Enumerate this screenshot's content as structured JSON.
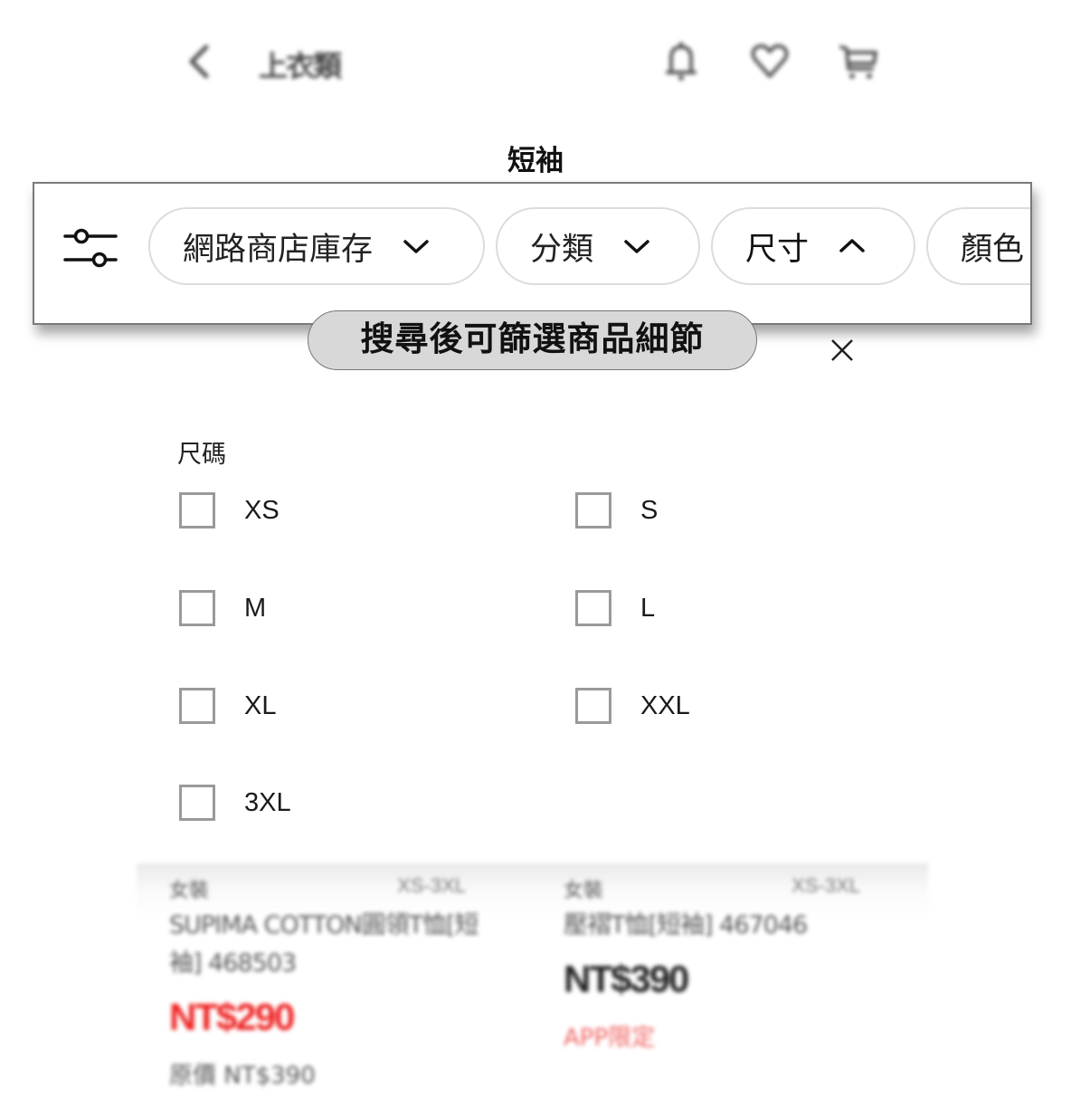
{
  "header": {
    "breadcrumb": "上衣類",
    "icons": [
      "chevron-left-icon",
      "bell-icon",
      "heart-icon",
      "cart-icon"
    ]
  },
  "page_title": "短袖",
  "filter_bar": {
    "filters": [
      {
        "label": "網路商店庫存",
        "state": "collapsed"
      },
      {
        "label": "分類",
        "state": "collapsed"
      },
      {
        "label": "尺寸",
        "state": "expanded"
      },
      {
        "label": "顏色",
        "state": "collapsed"
      }
    ]
  },
  "tooltip": {
    "text": "搜尋後可篩選商品細節"
  },
  "size_panel": {
    "title": "尺碼",
    "options": [
      {
        "label": "XS",
        "checked": false
      },
      {
        "label": "S",
        "checked": false
      },
      {
        "label": "M",
        "checked": false
      },
      {
        "label": "L",
        "checked": false
      },
      {
        "label": "XL",
        "checked": false
      },
      {
        "label": "XXL",
        "checked": false
      },
      {
        "label": "3XL",
        "checked": false
      }
    ]
  },
  "products": [
    {
      "category": "女裝",
      "size_range": "XS-3XL",
      "name": "SUPIMA COTTON圓領T恤[短袖] 468503",
      "price": "NT$290",
      "price_color": "#ee2222",
      "original_price": "原價 NT$390"
    },
    {
      "category": "女裝",
      "size_range": "XS-3XL",
      "name": "壓褶T恤[短袖] 467046",
      "price": "NT$390",
      "price_color": "#222222",
      "badge": "APP限定",
      "badge_color": "#f06060"
    }
  ]
}
